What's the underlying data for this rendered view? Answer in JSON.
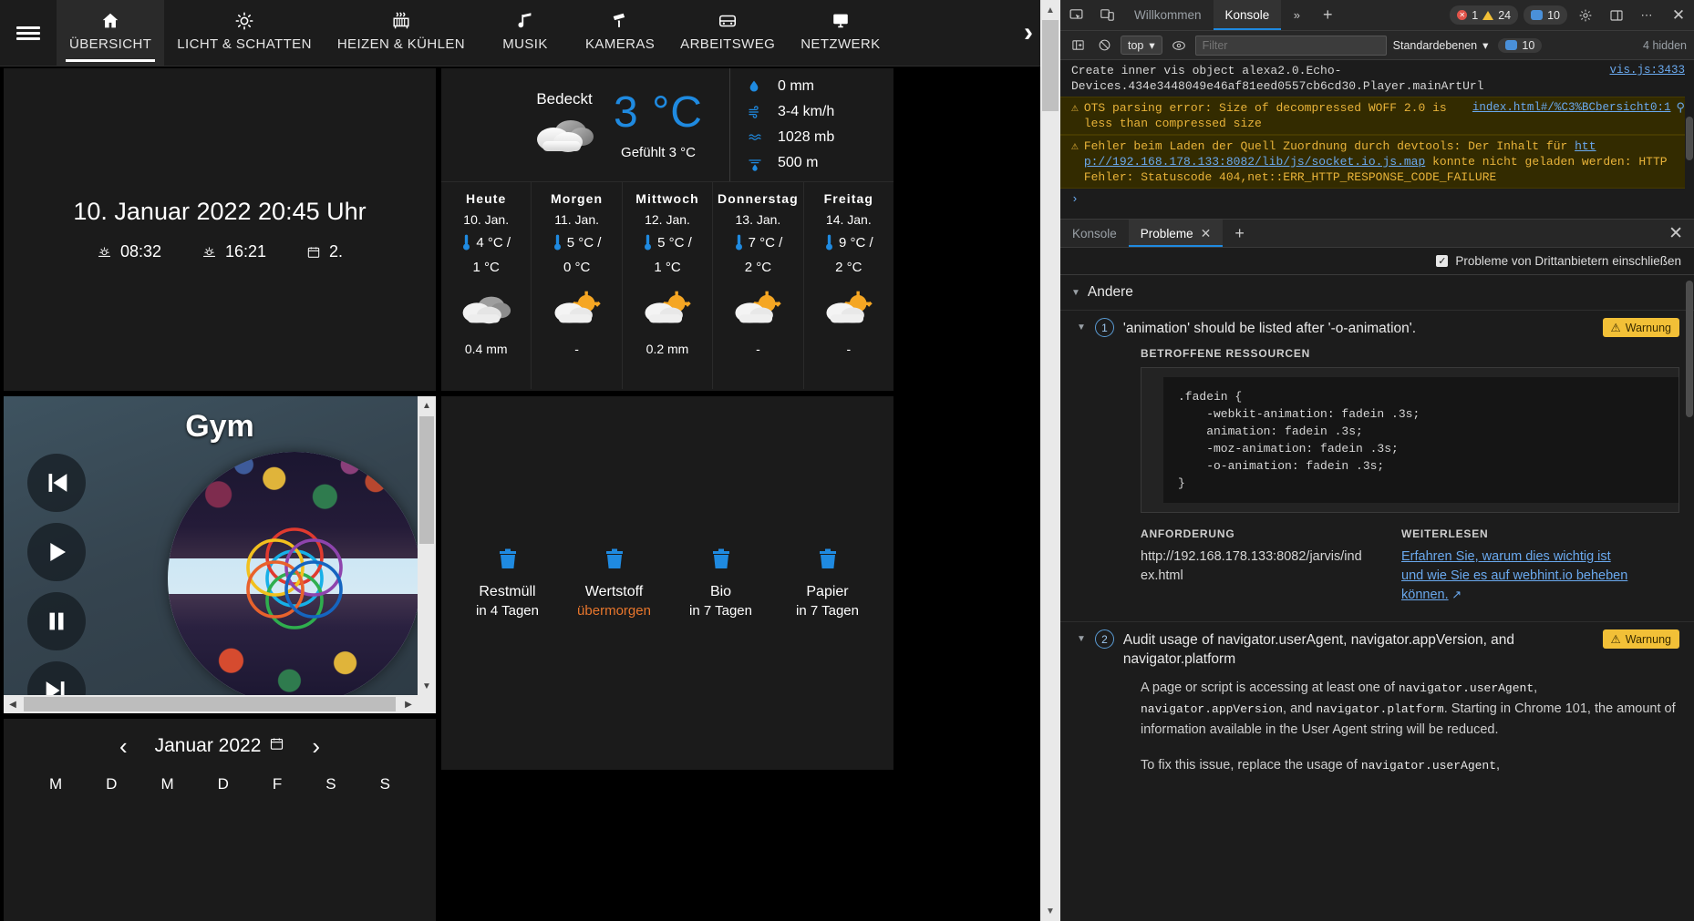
{
  "vis": {
    "nav": {
      "menu_icon": "hamburger-icon",
      "items": [
        {
          "label": "ÜBERSICHT",
          "icon": "home-icon",
          "active": true
        },
        {
          "label": "LICHT & SCHATTEN",
          "icon": "lightbulb-icon",
          "active": false
        },
        {
          "label": "HEIZEN & KÜHLEN",
          "icon": "radiator-icon",
          "active": false
        },
        {
          "label": "MUSIK",
          "icon": "music-note-icon",
          "active": false
        },
        {
          "label": "KAMERAS",
          "icon": "camera-cctv-icon",
          "active": false
        },
        {
          "label": "ARBEITSWEG",
          "icon": "car-icon",
          "active": false
        },
        {
          "label": "NETZWERK",
          "icon": "monitor-icon",
          "active": false
        }
      ],
      "more_icon": "chevron-right-icon"
    },
    "clock": {
      "datetime": "10. Januar 2022 20:45 Uhr",
      "sunrise": "08:32",
      "sunset": "16:21",
      "calendar_value": "2.",
      "sunrise_icon": "sunrise-icon",
      "sunset_icon": "sunset-icon",
      "calendar_icon": "calendar-icon"
    },
    "weather": {
      "condition": "Bedeckt",
      "condition_icon": "cloud-overcast-icon",
      "temperature": "3 °C",
      "feels_like": "Gefühlt 3 °C",
      "temp_color": "#1f8ae0",
      "stats": [
        {
          "icon": "rain-drop-icon",
          "value": "0 mm"
        },
        {
          "icon": "wind-icon",
          "value": "3-4 km/h"
        },
        {
          "icon": "pressure-icon",
          "value": "1028 mb"
        },
        {
          "icon": "visibility-icon",
          "value": "500 m"
        }
      ],
      "days": [
        {
          "name": "Heute",
          "date": "10. Jan.",
          "high": "4 °C /",
          "low": "1 °C",
          "icon": "cloud-overcast-icon",
          "precip": "0.4 mm"
        },
        {
          "name": "Morgen",
          "date": "11. Jan.",
          "high": "5 °C /",
          "low": "0 °C",
          "icon": "cloud-sun-icon",
          "precip": "-"
        },
        {
          "name": "Mittwoch",
          "date": "12. Jan.",
          "high": "5 °C /",
          "low": "1 °C",
          "icon": "cloud-sun-icon",
          "precip": "0.2 mm"
        },
        {
          "name": "Donnerstag",
          "date": "13. Jan.",
          "high": "7 °C /",
          "low": "2 °C",
          "icon": "cloud-sun-icon",
          "precip": "-"
        },
        {
          "name": "Freitag",
          "date": "14. Jan.",
          "high": "9 °C /",
          "low": "2 °C",
          "icon": "cloud-sun-icon",
          "precip": "-"
        }
      ]
    },
    "music": {
      "title": "Gym",
      "prev_icon": "skip-previous-icon",
      "play_icon": "play-icon",
      "pause_icon": "pause-icon",
      "next_icon": "skip-next-icon",
      "album_art": "album-cover-art"
    },
    "waste": [
      {
        "name": "Restmüll",
        "when": "in 4 Tagen",
        "due": false,
        "icon": "trash-bin-icon",
        "color": "#1f8ae0"
      },
      {
        "name": "Wertstoff",
        "when": "übermorgen",
        "due": true,
        "icon": "trash-bin-icon",
        "color": "#1f8ae0"
      },
      {
        "name": "Bio",
        "when": "in 7 Tagen",
        "due": false,
        "icon": "trash-bin-icon",
        "color": "#1f8ae0"
      },
      {
        "name": "Papier",
        "when": "in 7 Tagen",
        "due": false,
        "icon": "trash-bin-icon",
        "color": "#1f8ae0"
      }
    ],
    "calendar": {
      "prev_icon": "chevron-left-icon",
      "next_icon": "chevron-right-icon",
      "title": "Januar 2022",
      "title_icon": "calendar-icon",
      "weekdays": [
        "M",
        "D",
        "M",
        "D",
        "F",
        "S",
        "S"
      ]
    }
  },
  "devtools": {
    "toolbar": {
      "inspect_icon": "inspect-element-icon",
      "device_icon": "device-toolbar-icon",
      "tabs": [
        {
          "label": "Willkommen",
          "active": false
        },
        {
          "label": "Konsole",
          "active": true
        }
      ],
      "more_tabs_icon": "chevron-double-right-icon",
      "add_tab_icon": "plus-icon",
      "error_count": "1",
      "warning_count": "24",
      "message_count": "10",
      "settings_icon": "gear-icon",
      "customize_icon": "dock-side-icon",
      "kebab_icon": "more-vertical-icon",
      "close_icon": "close-icon"
    },
    "filterbar": {
      "sidebar_icon": "console-sidebar-icon",
      "clear_icon": "clear-console-icon",
      "context": "top",
      "context_caret": "chevron-down-icon",
      "eye_icon": "live-expression-icon",
      "filter_placeholder": "Filter",
      "filter_value": "",
      "levels_label": "Standardebenen",
      "levels_caret": "chevron-down-icon",
      "issue_count": "10",
      "hidden_label": "4 hidden"
    },
    "console_messages": [
      {
        "type": "plain",
        "text": "Create inner vis object alexa2.0.Echo-Devices.434e3448049e46af81eed0557cb6cd30.Player.mainArtUrl",
        "source": "vis.js:3433"
      },
      {
        "type": "warn",
        "text": "OTS parsing error: Size of decompressed WOFF 2.0 is less than compressed size",
        "source": "index.html#/%C3%BCbersicht0:1",
        "has_search_icon": true
      },
      {
        "type": "warn",
        "text_parts": [
          "Fehler beim Laden der Quell Zuordnung durch devtools: Der Inhalt für ",
          "htt p://192.168.178.133:8082/lib/js/socket.io.js.map",
          " konnte nicht geladen werden: HTTP Fehler: Statuscode 404,net::ERR_HTTP_RESPONSE_CODE_FAILURE"
        ],
        "source": ""
      }
    ],
    "prompt_icon": "prompt-chevron-icon",
    "drawer": {
      "tabs": [
        {
          "label": "Konsole",
          "active": false,
          "closable": false
        },
        {
          "label": "Probleme",
          "active": true,
          "closable": true
        }
      ],
      "close_tab_icon": "close-icon",
      "add_tab_icon": "plus-icon",
      "panel_close_icon": "close-icon",
      "thirdparty_label": "Probleme von Drittanbietern einschließen",
      "thirdparty_checked": true,
      "group_label": "Andere",
      "issues": [
        {
          "count": "1",
          "title": "'animation' should be listed after '-o-animation'.",
          "severity": "Warnung",
          "severity_icon": "warning-triangle-icon",
          "resources_label": "BETROFFENE RESSOURCEN",
          "code": ".fadein {\n    -webkit-animation: fadein .3s;\n    animation: fadein .3s;\n    -moz-animation: fadein .3s;\n    -o-animation: fadein .3s;\n}",
          "request_label": "ANFORDERUNG",
          "request_value": "http://192.168.178.133:8082/jarvis/index.html",
          "more_label": "WEITERLESEN",
          "more_link": "Erfahren Sie, warum dies wichtig ist und wie Sie es auf webhint.io beheben können.",
          "more_link_icon": "open-external-icon"
        },
        {
          "count": "2",
          "title": "Audit usage of navigator.userAgent, navigator.appVersion, and navigator.platform",
          "severity": "Warnung",
          "severity_icon": "warning-triangle-icon",
          "paragraph1_a": "A page or script is accessing at least one of ",
          "paragraph1_code1": "navigator.userAgent",
          "paragraph1_b": ", ",
          "paragraph1_code2": "navigator.appVersion",
          "paragraph1_c": ", and ",
          "paragraph1_code3": "navigator.platform",
          "paragraph1_d": ". Starting in Chrome 101, the amount of information available in the User Agent string will be reduced.",
          "paragraph2_a": "To fix this issue, replace the usage of ",
          "paragraph2_code1": "navigator.userAgent",
          "paragraph2_b": ","
        }
      ]
    }
  }
}
